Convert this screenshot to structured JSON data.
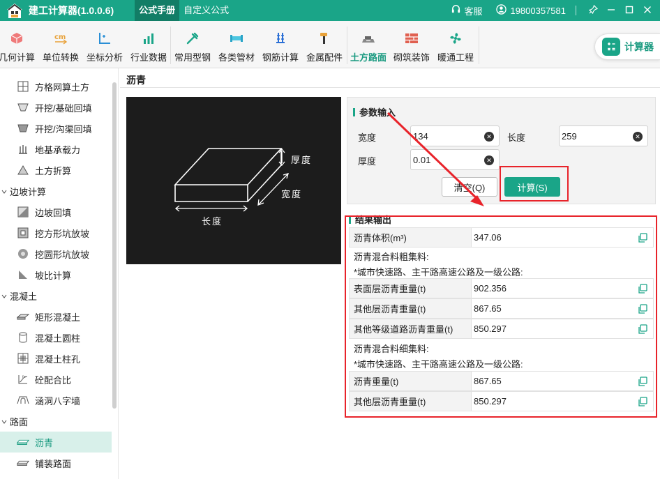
{
  "app": {
    "title": "建工计算器(1.0.0.6)"
  },
  "menu": {
    "tabs": [
      {
        "label": "公式手册"
      },
      {
        "label": "自定义公式"
      }
    ]
  },
  "header": {
    "service_label": "客服",
    "user_phone": "19800357581"
  },
  "toolbar": {
    "items": [
      {
        "label": "几何计算",
        "icon": "cube-icon"
      },
      {
        "label": "单位转换",
        "icon": "cm-unit-icon"
      },
      {
        "label": "坐标分析",
        "icon": "axis-icon"
      },
      {
        "label": "行业数据",
        "icon": "bar-chart-icon"
      },
      {
        "label": "常用型钢",
        "icon": "wrench-icon"
      },
      {
        "label": "各类管材",
        "icon": "pipe-icon"
      },
      {
        "label": "钢筋计算",
        "icon": "rebar-icon"
      },
      {
        "label": "金属配件",
        "icon": "hammer-icon"
      },
      {
        "label": "土方路面",
        "icon": "road-icon"
      },
      {
        "label": "砌筑装饰",
        "icon": "brick-icon"
      },
      {
        "label": "暖通工程",
        "icon": "fan-icon"
      }
    ],
    "calculator_label": "计算器"
  },
  "sidebar": {
    "items": [
      {
        "label": "方格网算土方"
      },
      {
        "label": "开挖/基础回填"
      },
      {
        "label": "开挖/沟渠回填"
      },
      {
        "label": "地基承载力"
      },
      {
        "label": "土方折算"
      }
    ],
    "cat_slope": "边坡计算",
    "slope_items": [
      {
        "label": "边坡回填"
      },
      {
        "label": "挖方形坑放坡"
      },
      {
        "label": "挖圆形坑放坡"
      },
      {
        "label": "坡比计算"
      }
    ],
    "cat_concrete": "混凝土",
    "concrete_items": [
      {
        "label": "矩形混凝土"
      },
      {
        "label": "混凝土圆柱"
      },
      {
        "label": "混凝土柱孔"
      },
      {
        "label": "砼配合比"
      },
      {
        "label": "涵洞八字墙"
      }
    ],
    "cat_road": "路面",
    "road_items": [
      {
        "label": "沥青"
      },
      {
        "label": "铺装路面"
      }
    ]
  },
  "page": {
    "title": "沥青"
  },
  "diagram": {
    "thickness": "厚度",
    "width": "宽度",
    "length": "长度"
  },
  "params": {
    "title": "参数输入",
    "width_label": "宽度",
    "width_value": "134",
    "length_label": "长度",
    "length_value": "259",
    "thickness_label": "厚度",
    "thickness_value": "0.01",
    "clear_label": "清空(Q)",
    "calc_label": "计算(S)"
  },
  "results": {
    "title": "结果输出",
    "volume_label": "沥青体积(m³)",
    "volume_value": "347.06",
    "coarse_note": "沥青混合料粗集料:",
    "coarse_scope": "*城市快速路、主干路高速公路及一级公路:",
    "coarse_rows": [
      {
        "label": "表面层沥青重量(t)",
        "value": "902.356"
      },
      {
        "label": "其他层沥青重量(t)",
        "value": "867.65"
      },
      {
        "label": "其他等级道路沥青重量(t)",
        "value": "850.297"
      }
    ],
    "fine_note": "沥青混合料细集料:",
    "fine_scope": "*城市快速路、主干路高速公路及一级公路:",
    "fine_rows": [
      {
        "label": "沥青重量(t)",
        "value": "867.65"
      },
      {
        "label": "其他层沥青重量(t)",
        "value": "850.297"
      }
    ]
  },
  "colors": {
    "brand": "#1aa588",
    "highlight": "#e8232a"
  }
}
